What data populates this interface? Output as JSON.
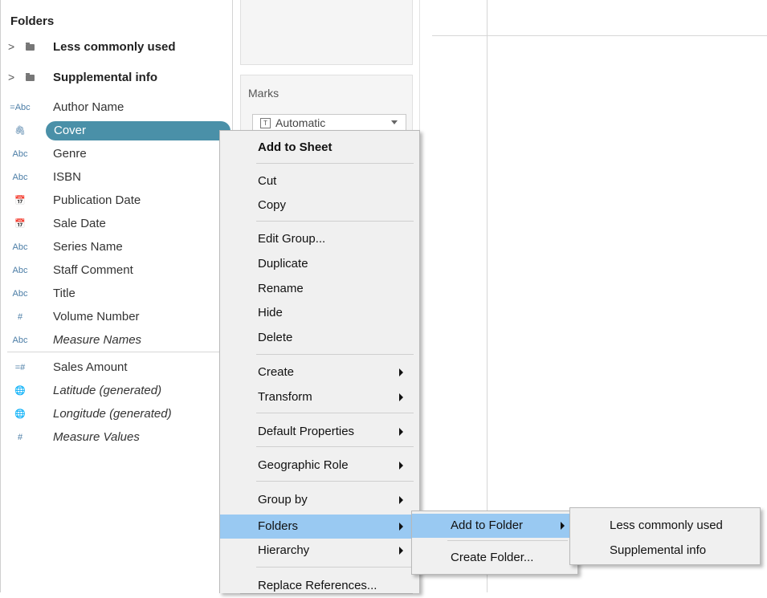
{
  "data_pane": {
    "header": "Folders",
    "folders": [
      {
        "label": "Less commonly used"
      },
      {
        "label": "Supplemental info"
      }
    ],
    "fields": [
      {
        "icon_text": "=Abc",
        "icon": "calculated-string-icon",
        "label": "Author Name",
        "italic": false,
        "selected": false
      },
      {
        "icon_text": "🖇",
        "icon": "paperclip-icon",
        "label": "Cover",
        "italic": false,
        "selected": true
      },
      {
        "icon_text": "Abc",
        "icon": "string-icon",
        "label": "Genre",
        "italic": false,
        "selected": false
      },
      {
        "icon_text": "Abc",
        "icon": "string-icon",
        "label": "ISBN",
        "italic": false,
        "selected": false
      },
      {
        "icon_text": "📅",
        "icon": "calendar-icon",
        "label": "Publication Date",
        "italic": false,
        "selected": false
      },
      {
        "icon_text": "📅",
        "icon": "calendar-icon",
        "label": "Sale Date",
        "italic": false,
        "selected": false
      },
      {
        "icon_text": "Abc",
        "icon": "string-icon",
        "label": "Series Name",
        "italic": false,
        "selected": false
      },
      {
        "icon_text": "Abc",
        "icon": "string-icon",
        "label": "Staff Comment",
        "italic": false,
        "selected": false
      },
      {
        "icon_text": "Abc",
        "icon": "string-icon",
        "label": "Title",
        "italic": false,
        "selected": false
      },
      {
        "icon_text": "#",
        "icon": "number-icon",
        "label": "Volume Number",
        "italic": false,
        "selected": false
      },
      {
        "icon_text": "Abc",
        "icon": "string-icon",
        "label": "Measure Names",
        "italic": true,
        "selected": false
      }
    ],
    "measures": [
      {
        "icon_text": "=#",
        "icon": "calculated-number-icon",
        "label": "Sales Amount",
        "italic": false
      },
      {
        "icon_text": "🌐",
        "icon": "globe-icon",
        "label": "Latitude (generated)",
        "italic": true
      },
      {
        "icon_text": "🌐",
        "icon": "globe-icon",
        "label": "Longitude (generated)",
        "italic": true
      },
      {
        "icon_text": "#",
        "icon": "number-icon",
        "label": "Measure Values",
        "italic": true
      }
    ]
  },
  "marks": {
    "title": "Marks",
    "mark_type": "Automatic",
    "mark_type_icon": "T"
  },
  "context_menu": {
    "items": [
      {
        "label": "Add to Sheet",
        "bold": true,
        "submenu": false,
        "highlighted": false
      },
      {
        "label": "Cut",
        "bold": false,
        "submenu": false,
        "highlighted": false
      },
      {
        "label": "Copy",
        "bold": false,
        "submenu": false,
        "highlighted": false
      },
      {
        "label": "Edit Group...",
        "bold": false,
        "submenu": false,
        "highlighted": false
      },
      {
        "label": "Duplicate",
        "bold": false,
        "submenu": false,
        "highlighted": false
      },
      {
        "label": "Rename",
        "bold": false,
        "submenu": false,
        "highlighted": false
      },
      {
        "label": "Hide",
        "bold": false,
        "submenu": false,
        "highlighted": false
      },
      {
        "label": "Delete",
        "bold": false,
        "submenu": false,
        "highlighted": false
      },
      {
        "label": "Create",
        "bold": false,
        "submenu": true,
        "highlighted": false
      },
      {
        "label": "Transform",
        "bold": false,
        "submenu": true,
        "highlighted": false
      },
      {
        "label": "Default Properties",
        "bold": false,
        "submenu": true,
        "highlighted": false
      },
      {
        "label": "Geographic Role",
        "bold": false,
        "submenu": true,
        "highlighted": false
      },
      {
        "label": "Group by",
        "bold": false,
        "submenu": true,
        "highlighted": false
      },
      {
        "label": "Folders",
        "bold": false,
        "submenu": true,
        "highlighted": true
      },
      {
        "label": "Hierarchy",
        "bold": false,
        "submenu": true,
        "highlighted": false
      },
      {
        "label": "Replace References...",
        "bold": false,
        "submenu": false,
        "highlighted": false
      }
    ]
  },
  "folders_submenu": {
    "items": [
      {
        "label": "Add to Folder",
        "submenu": true,
        "highlighted": true
      },
      {
        "label": "Create Folder...",
        "submenu": false,
        "highlighted": false
      }
    ]
  },
  "add_to_folder_submenu": {
    "items": [
      {
        "label": "Less commonly used"
      },
      {
        "label": "Supplemental info"
      }
    ]
  },
  "colors": {
    "selection_pill": "#4a90a8",
    "menu_highlight": "#99c9f2",
    "menu_background": "#f0f0f0",
    "field_icon": "#4b7da6"
  }
}
